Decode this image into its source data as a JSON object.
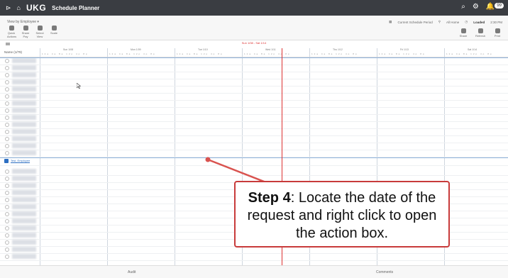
{
  "topbar": {
    "logo": "UKG",
    "title": "Schedule Planner",
    "badge": "99"
  },
  "toolbar": {
    "view_selector": "View by Employee ▾",
    "tools": [
      "Quick Actions",
      "Share Pay",
      "Select View",
      "Scale"
    ],
    "schedule_period": "Current Schedule Period",
    "locations": "All Home",
    "loaded": "Loaded",
    "time": "2:30 PM",
    "right_tools": [
      "Share",
      "Refresh",
      "Print"
    ]
  },
  "date_range": "Sun 1/08 - Sat 1/14",
  "grid": {
    "name_header": "Name (1/79)",
    "days": [
      "Sun 1/08",
      "Mon 1/09",
      "Tue 1/10",
      "Wed 1/11",
      "Thu 1/12",
      "Fri 1/13",
      "Sat 1/14"
    ],
    "hours": "12a  4a  8a  12p  4p  8p"
  },
  "selected_employee": "Test, Employee",
  "bottom": {
    "left": "Audit",
    "right": "Comments"
  },
  "callout": {
    "step": "Step 4",
    "text": ": Locate the date of the request and right click to open the action box."
  }
}
